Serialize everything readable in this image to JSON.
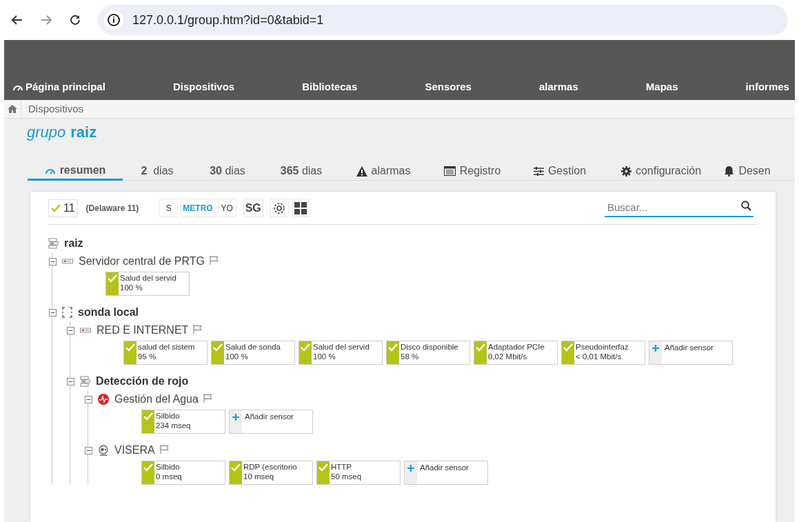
{
  "browser": {
    "url": "127.0.0.1/group.htm?id=0&tabid=1"
  },
  "nav": [
    {
      "label": "Página principal"
    },
    {
      "label": "Dispositivos"
    },
    {
      "label": "Bibliotecas"
    },
    {
      "label": "Sensores"
    },
    {
      "label": "alarmas"
    },
    {
      "label": "Mapas"
    },
    {
      "label": "informes"
    }
  ],
  "breadcrumb": [
    "Dispositivos"
  ],
  "title": {
    "prefix": "grupo",
    "name": "raiz"
  },
  "tabs": [
    {
      "label": "resumen",
      "selected": true
    },
    {
      "label": "**2**  dias",
      "selected": false
    },
    {
      "label": "**30** dias",
      "selected": false
    },
    {
      "label": "**365** dias",
      "selected": false
    },
    {
      "label": "alarmas",
      "selected": false
    },
    {
      "label": "Registro",
      "selected": false
    },
    {
      "label": "Gestion",
      "selected": false
    },
    {
      "label": "configuración",
      "selected": false
    },
    {
      "label": "Desen",
      "selected": false
    }
  ],
  "toolbar": {
    "ok_count": "11",
    "summary": "(Delaware 11)",
    "buttons": [
      {
        "kind": "text",
        "label": "S"
      },
      {
        "kind": "accent",
        "label": "METRO"
      },
      {
        "kind": "text",
        "label": "YO"
      },
      {
        "kind": "bold",
        "label": "SG"
      },
      {
        "kind": "target"
      },
      {
        "kind": "grid"
      }
    ],
    "search": {
      "placeholder": "Buscar..."
    }
  },
  "tree": [
    {
      "name": "raiz",
      "kind": "group",
      "children": [
        {
          "name": "Servidor central de PRTG",
          "kind": "server",
          "flag": true,
          "expanded": true,
          "sensors": [
            {
              "kind": "sensor",
              "name": "Salud del servid",
              "value": "100 %"
            }
          ]
        },
        {
          "name": "sonda local",
          "kind": "probe",
          "expanded": true,
          "children": [
            {
              "name": "RED E INTERNET",
              "kind": "server",
              "flag": true,
              "expanded": true,
              "sensors": [
                {
                  "kind": "sensor",
                  "name": "salud del sistem",
                  "value": "95 %"
                },
                {
                  "kind": "sensor",
                  "name": "Salud de sonda",
                  "value": "100 %"
                },
                {
                  "kind": "sensor",
                  "name": "Salud del servid",
                  "value": "100 %"
                },
                {
                  "kind": "sensor",
                  "name": "Disco disponible",
                  "value": "58 %"
                },
                {
                  "kind": "sensor",
                  "name": "Adaptador PCIe",
                  "value": "0,02 Mbit/s"
                },
                {
                  "kind": "sensor",
                  "name": "Pseudointerfaz",
                  "value": "< 0,01 Mbit/s"
                },
                {
                  "kind": "add",
                  "name": "Añadir sensor"
                }
              ]
            },
            {
              "name": "Detección de rojo",
              "kind": "group",
              "expanded": true,
              "children": [
                {
                  "name": "Gestión del Agua",
                  "kind": "monitor",
                  "flag": true,
                  "expanded": true,
                  "sensors": [
                    {
                      "kind": "sensor",
                      "name": "Silbido",
                      "value": "234 mseq"
                    },
                    {
                      "kind": "add",
                      "name": "Añadir sensor"
                    }
                  ]
                },
                {
                  "name": "VISERA",
                  "kind": "camera",
                  "flag": true,
                  "expanded": true,
                  "sensors": [
                    {
                      "kind": "sensor",
                      "name": "Silbido",
                      "value": "0 mseq"
                    },
                    {
                      "kind": "sensor",
                      "name": "RDP (escritorio",
                      "value": "10 mseq"
                    },
                    {
                      "kind": "sensor",
                      "name": "HTTP",
                      "value": "50 mseq"
                    },
                    {
                      "kind": "add",
                      "name": "Añadir sensor"
                    }
                  ]
                }
              ]
            }
          ]
        }
      ]
    }
  ]
}
